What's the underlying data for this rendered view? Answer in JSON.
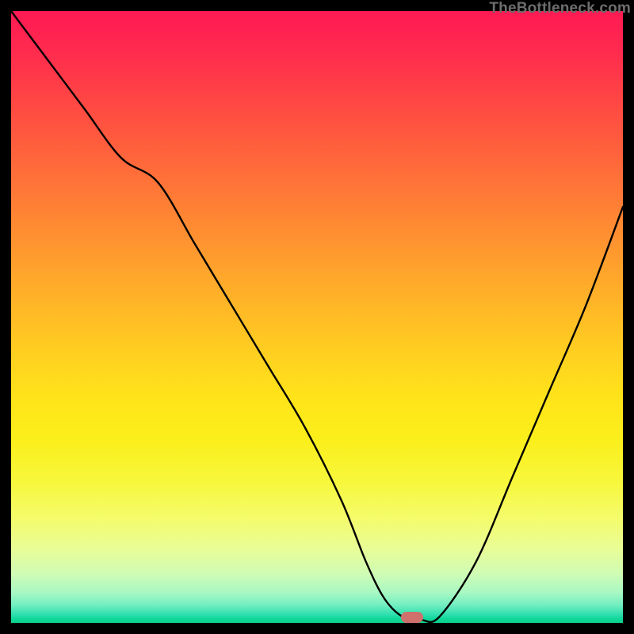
{
  "watermark": "TheBottleneck.com",
  "marker": {
    "x_pct": 65.5,
    "y_pct": 99.1,
    "color": "#cf706c"
  },
  "chart_data": {
    "type": "line",
    "title": "",
    "xlabel": "",
    "ylabel": "",
    "xlim": [
      0,
      100
    ],
    "ylim": [
      0,
      100
    ],
    "grid": false,
    "legend": false,
    "series": [
      {
        "name": "bottleneck-curve",
        "x": [
          0,
          6,
          12,
          18,
          24,
          30,
          36,
          42,
          48,
          54,
          58,
          61,
          64,
          67,
          70,
          76,
          82,
          88,
          94,
          100
        ],
        "y": [
          100,
          92,
          84,
          76,
          72,
          62,
          52,
          42,
          32,
          20,
          10,
          4,
          1,
          0.5,
          1,
          10,
          24,
          38,
          52,
          68
        ]
      }
    ],
    "marker_point": {
      "x": 65.5,
      "y": 0.9
    },
    "background_gradient": {
      "orientation": "vertical",
      "stops": [
        {
          "pct": 0,
          "color": "#ff1a53"
        },
        {
          "pct": 50,
          "color": "#ffb926"
        },
        {
          "pct": 80,
          "color": "#f7f73c"
        },
        {
          "pct": 100,
          "color": "#0bd18b"
        }
      ]
    }
  }
}
